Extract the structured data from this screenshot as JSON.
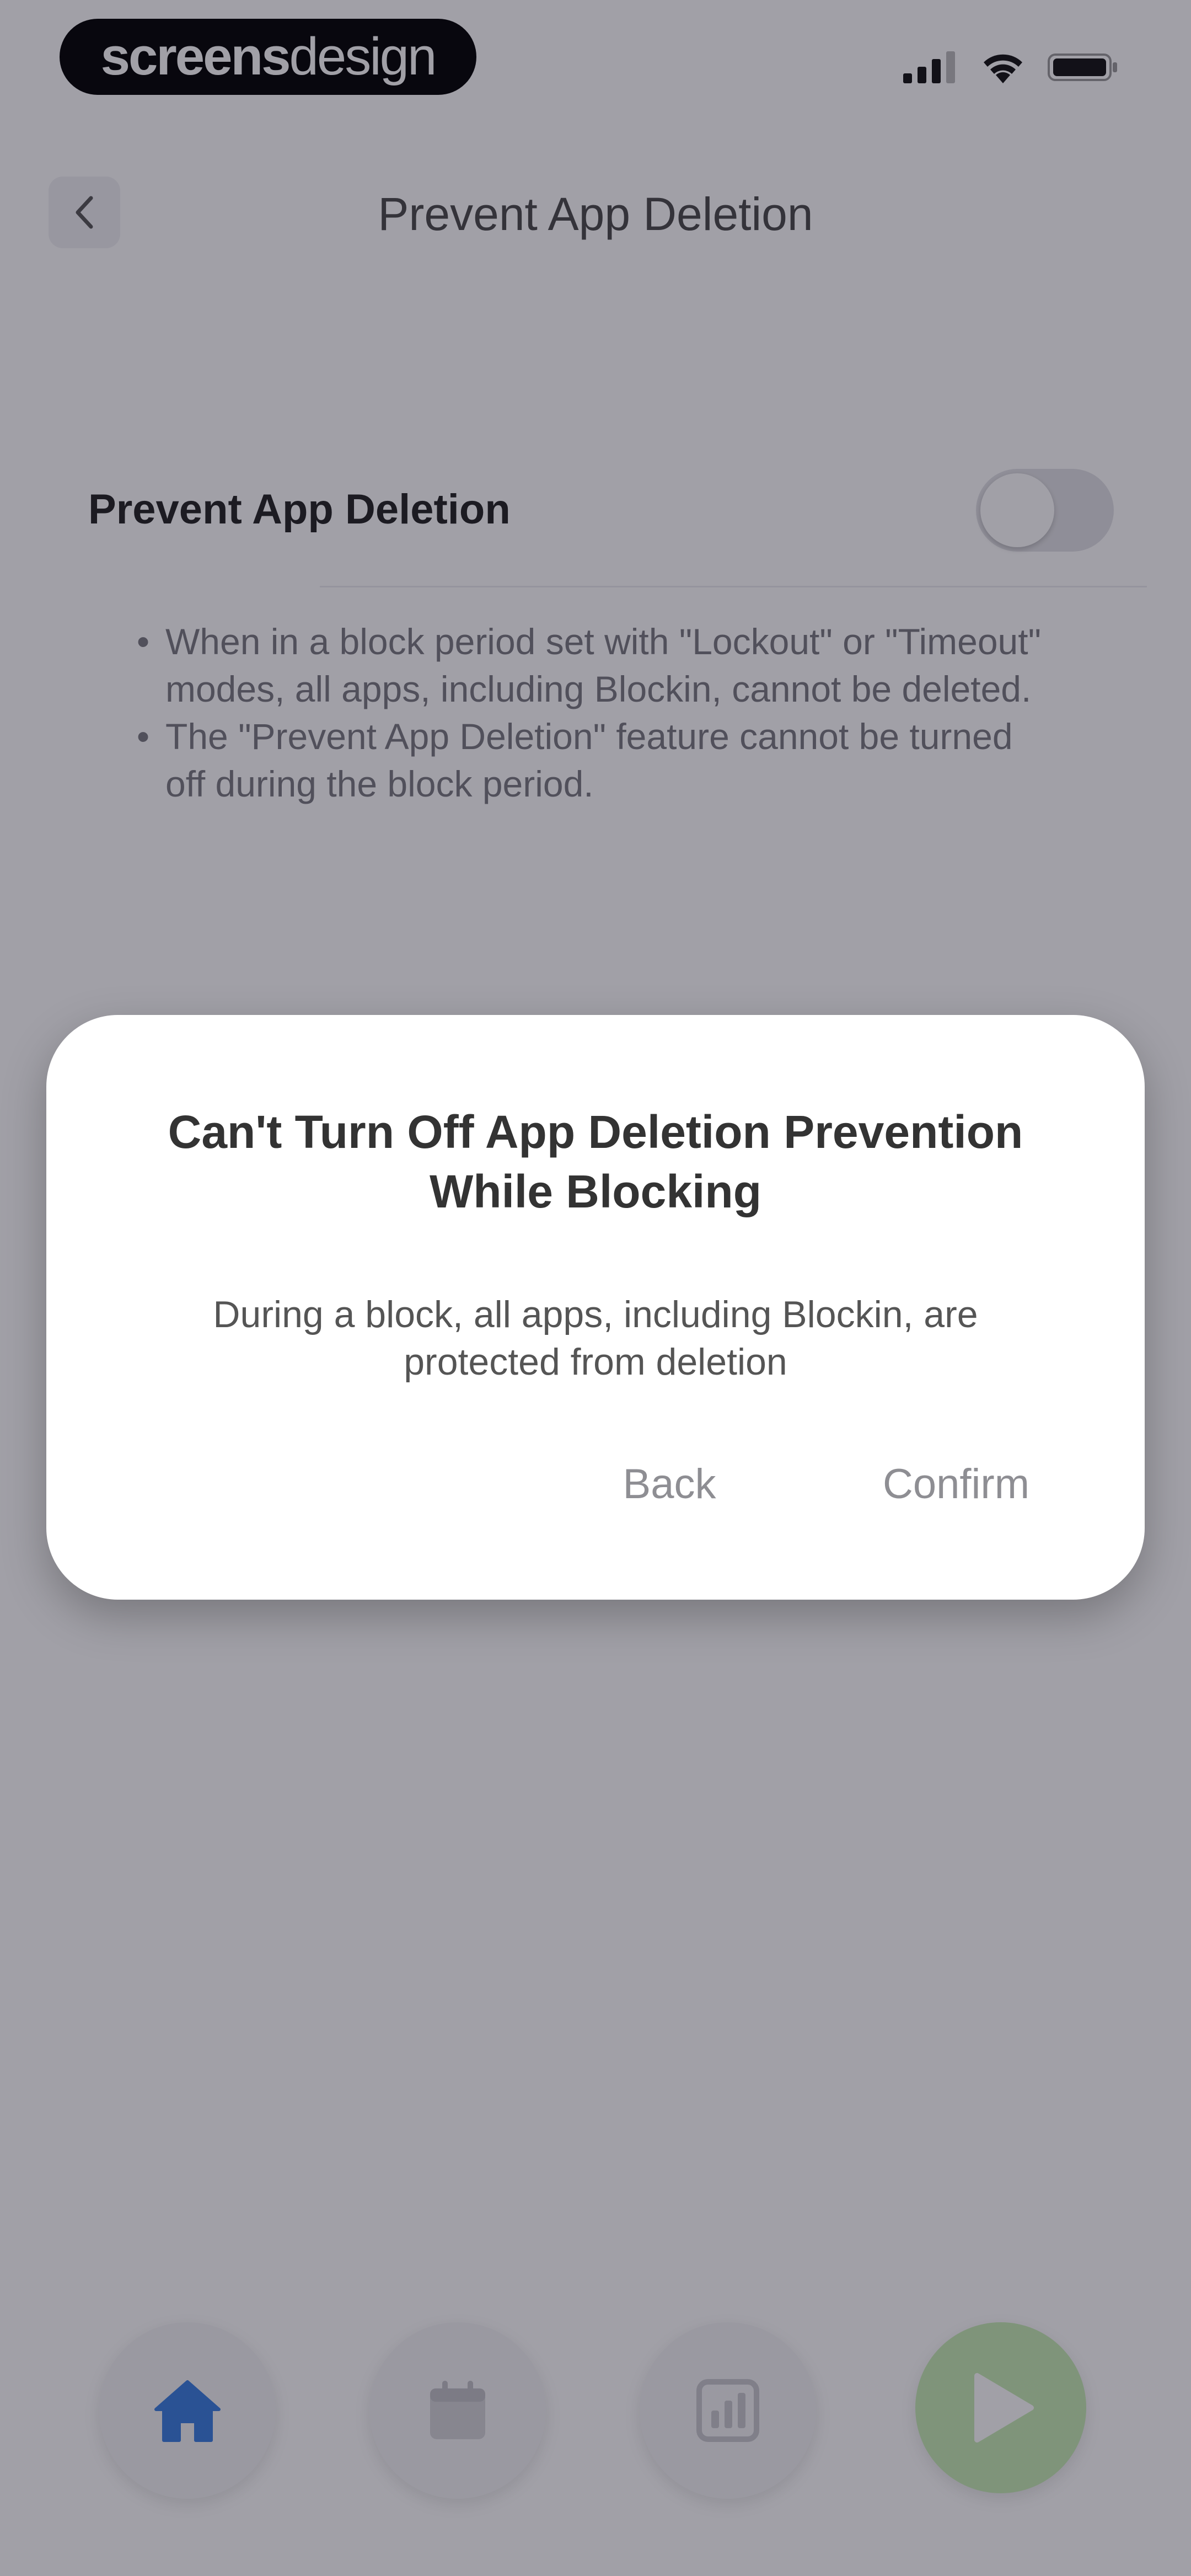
{
  "watermark": {
    "text_bold": "screens",
    "text_light": "design"
  },
  "status_bar": {
    "icons": [
      "cellular-signal-icon",
      "wifi-icon",
      "battery-icon"
    ]
  },
  "nav": {
    "back_icon": "chevron-left-icon",
    "title": "Prevent App Deletion"
  },
  "setting": {
    "label": "Prevent App Deletion",
    "toggle_on": false,
    "notes": [
      "When in a block period set with \"Lockout\" or \"Timeout\" modes, all apps, including Blockin, cannot be deleted.",
      "The \"Prevent App Deletion\" feature cannot be turned off during the block period."
    ]
  },
  "dialog": {
    "title": "Can't Turn Off App Deletion Prevention While Blocking",
    "message": "During a block, all apps, including Blockin, are protected from deletion",
    "back_label": "Back",
    "confirm_label": "Confirm"
  },
  "tab_bar": {
    "tabs": [
      {
        "icon": "home-icon",
        "active": true
      },
      {
        "icon": "calendar-icon",
        "active": false
      },
      {
        "icon": "stats-icon",
        "active": false
      },
      {
        "icon": "play-icon",
        "active": false
      }
    ]
  },
  "colors": {
    "accent_home": "#3a7de0",
    "play_button": "#c7ecb4",
    "play_icon": "#ffffff",
    "overlay": "#14122366"
  }
}
